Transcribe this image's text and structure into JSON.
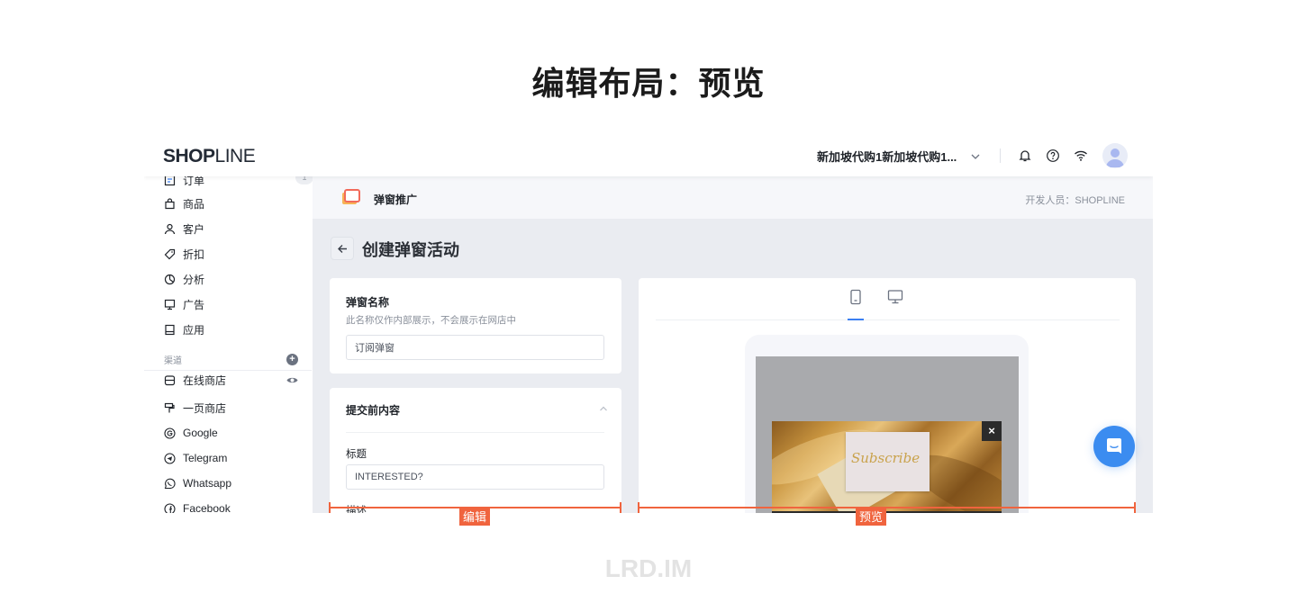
{
  "slide": {
    "title": "编辑布局：预览",
    "watermark": "LRD.IM"
  },
  "topbar": {
    "logo_bold": "SHOP",
    "logo_thin": "LINE",
    "store_name": "新加坡代购1新加坡代购1...",
    "icons": [
      "bell-icon",
      "help-icon",
      "wifi-icon",
      "avatar"
    ]
  },
  "sidebar": {
    "items": [
      {
        "label": "订单",
        "icon": "order-icon",
        "badge": "1"
      },
      {
        "label": "商品",
        "icon": "bag-icon"
      },
      {
        "label": "客户",
        "icon": "user-icon"
      },
      {
        "label": "折扣",
        "icon": "tag-icon"
      },
      {
        "label": "分析",
        "icon": "pie-chart-icon"
      },
      {
        "label": "广告",
        "icon": "monitor-icon"
      },
      {
        "label": "应用",
        "icon": "app-icon"
      }
    ],
    "channels_label": "渠道",
    "channels": [
      {
        "label": "在线商店",
        "icon": "store-icon"
      },
      {
        "label": "一页商店",
        "icon": "paint-roller-icon"
      },
      {
        "label": "Google",
        "icon": "google-icon"
      },
      {
        "label": "Telegram",
        "icon": "telegram-icon"
      },
      {
        "label": "Whatsapp",
        "icon": "whatsapp-icon"
      },
      {
        "label": "Facebook",
        "icon": "facebook-icon"
      }
    ]
  },
  "app_header": {
    "name": "弹窗推广",
    "developer": "开发人员：SHOPLINE"
  },
  "page": {
    "heading": "创建弹窗活动"
  },
  "name_card": {
    "title": "弹窗名称",
    "hint": "此名称仅作内部展示，不会展示在网店中",
    "value": "订阅弹窗"
  },
  "content_card": {
    "title": "提交前内容",
    "title_label": "标题",
    "title_value": "INTERESTED?",
    "desc_label": "描述"
  },
  "preview": {
    "active_tab": "mobile",
    "tabs": [
      "mobile",
      "desktop"
    ],
    "image_text": "Subscribe",
    "close_label": "×"
  },
  "annotations": {
    "edit": "编辑",
    "preview": "预览",
    "color": "#f0643e"
  }
}
